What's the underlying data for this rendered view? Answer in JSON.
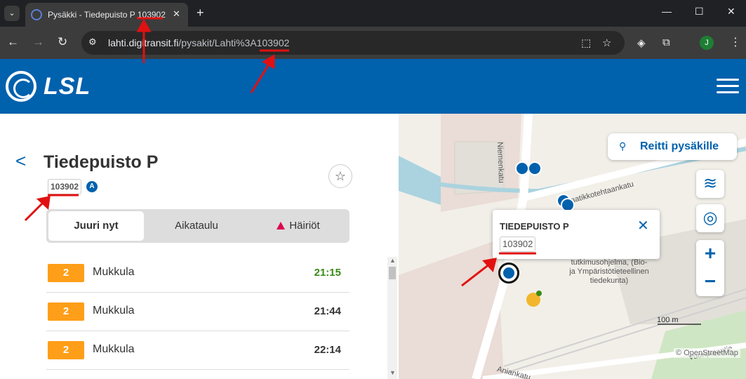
{
  "browser": {
    "tab_title": "Pysäkki - Tiedepuisto P 103902",
    "url_host": "lahti.digitransit.fi",
    "url_path": "/pysakit/Lahti%3A103902",
    "profile_initial": "J"
  },
  "header": {
    "logo_text": "LSL"
  },
  "stop": {
    "name": "Tiedepuisto P",
    "code": "103902",
    "zone": "A"
  },
  "tabs": [
    {
      "label": "Juuri nyt"
    },
    {
      "label": "Aikataulu"
    },
    {
      "label": "Häiriöt"
    }
  ],
  "departures": [
    {
      "route": "2",
      "headsign": "Mukkula",
      "time": "21:15",
      "realtime": true
    },
    {
      "route": "2",
      "headsign": "Mukkula",
      "time": "21:44",
      "realtime": false
    },
    {
      "route": "2",
      "headsign": "Mukkula",
      "time": "22:14",
      "realtime": false
    }
  ],
  "map": {
    "route_button": "Reitti pysäkille",
    "popup_title": "TIEDEPUISTO P",
    "popup_code": "103902",
    "poi_label": "tutkimusohjelma, (Bio- ja Ympäristötieteellinen tiedekunta)",
    "street_1": "Niemenkatu",
    "street_2": "Laatikkotehtaankatu",
    "street_3": "Vuoripojantie",
    "street_4": "Aniankatu",
    "scale": "100 m",
    "attribution": "© OpenStreetMap"
  },
  "colors": {
    "brand": "#0061ad",
    "route_badge": "#ff9e18",
    "realtime": "#3a8a16",
    "alert": "#dc0451",
    "annotation": "#e11111"
  }
}
